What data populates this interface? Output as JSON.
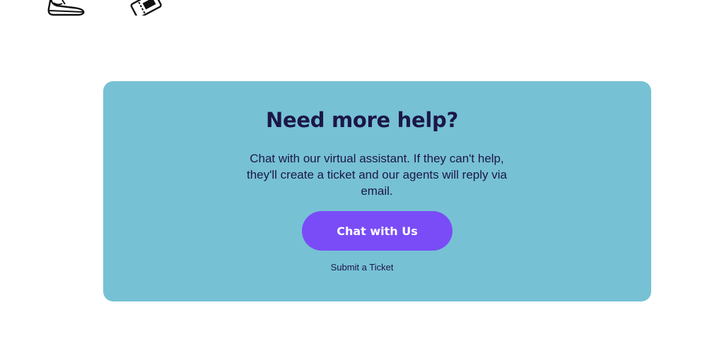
{
  "colors": {
    "page_background": "#ffffff",
    "card_background": "#77c1d5",
    "heading_text": "#1b1747",
    "body_text": "#1b1747",
    "button_background": "#7a4cf7",
    "button_text": "#ffffff"
  },
  "top_icons": [
    {
      "icon": "sneaker-icon"
    },
    {
      "icon": "ticket-icon"
    }
  ],
  "help_card": {
    "title": "Need more help?",
    "description": "Chat with our virtual assistant. If they can't help, they'll create a ticket and our agents will reply via email.",
    "chat_button_label": "Chat with Us",
    "submit_ticket_label": "Submit a Ticket"
  }
}
